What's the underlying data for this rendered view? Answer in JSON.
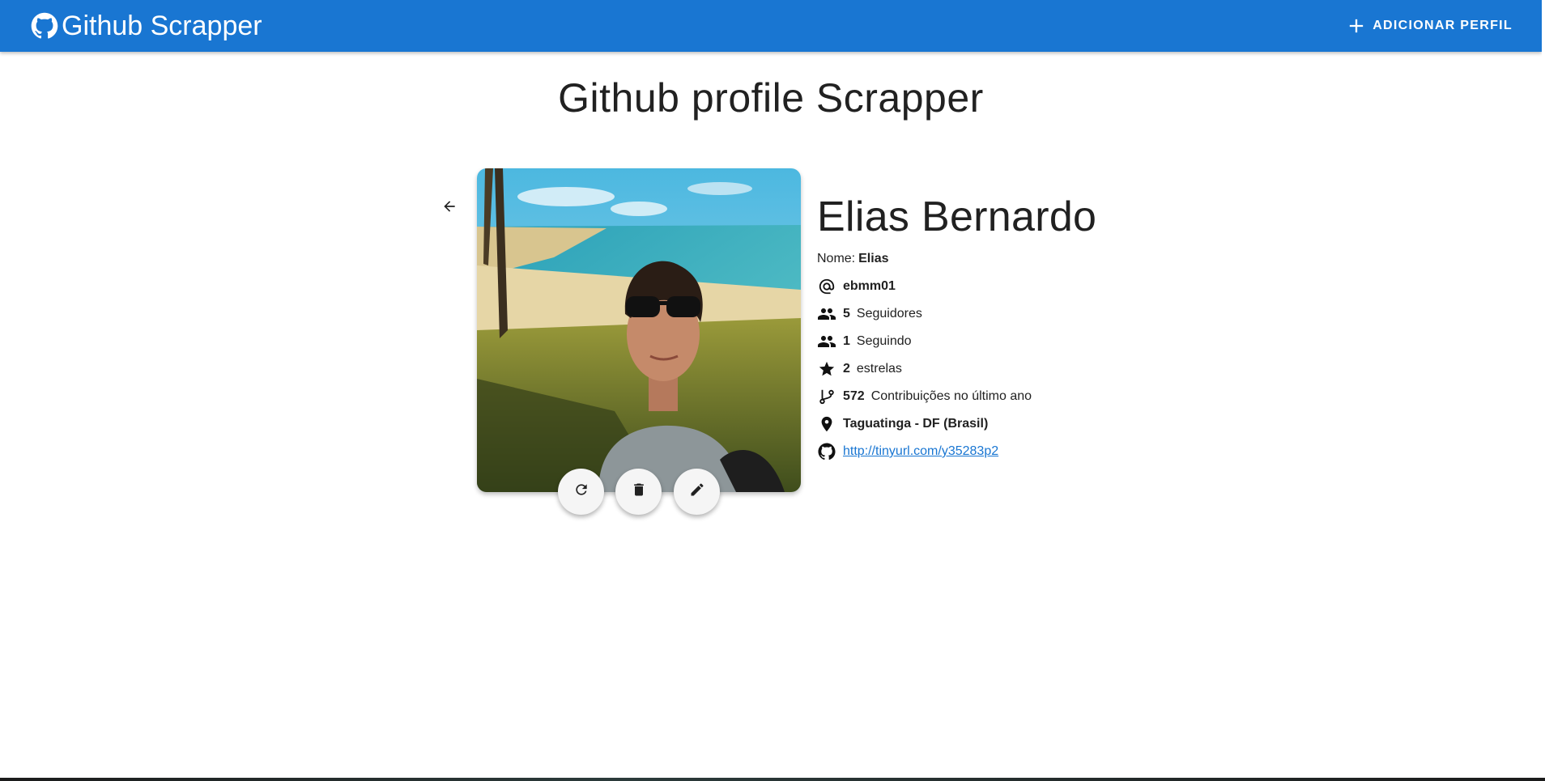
{
  "appbar": {
    "title": "Github Scrapper",
    "logo_icon": "github-icon",
    "add_button_label": "ADICIONAR PERFIL",
    "add_icon": "plus-icon",
    "background": "#1976d2"
  },
  "page": {
    "title": "Github profile Scrapper"
  },
  "profile": {
    "name": "Elias Bernardo",
    "nome_label": "Nome:",
    "nome_value": "Elias",
    "username": "ebmm01",
    "followers_count": "5",
    "followers_label": "Seguidores",
    "following_count": "1",
    "following_label": "Seguindo",
    "stars_count": "2",
    "stars_label": "estrelas",
    "contributions_count": "572",
    "contributions_label": "Contribuições no último ano",
    "location": "Taguatinga - DF (Brasil)",
    "url": "http://tinyurl.com/y35283p2"
  },
  "actions": {
    "back_icon": "arrow-back-icon",
    "refresh_icon": "refresh-icon",
    "delete_icon": "trash-icon",
    "edit_icon": "pencil-icon"
  },
  "colors": {
    "link": "#1976d2",
    "fab_bg": "#f5f5f5"
  }
}
